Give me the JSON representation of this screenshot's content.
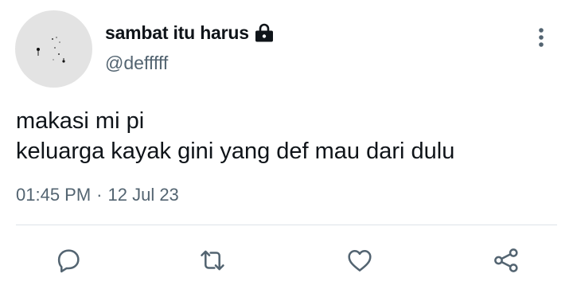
{
  "author": {
    "display_name": "sambat itu harus",
    "handle": "@defffff",
    "protected": true
  },
  "tweet": {
    "lines": [
      "makasi mi pi",
      "keluarga kayak gini yang def mau dari dulu"
    ],
    "time": "01:45 PM",
    "separator": "·",
    "date": "12 Jul 23"
  },
  "icons": {
    "lock": "lock-icon",
    "more": "more-vertical-icon",
    "reply": "reply-icon",
    "retweet": "retweet-icon",
    "like": "heart-icon",
    "share": "share-icon"
  },
  "colors": {
    "text": "#0f1419",
    "secondary": "#536471",
    "icon": "#536471",
    "divider": "#dde3e8",
    "avatar_bg": "#e3e3e3"
  }
}
